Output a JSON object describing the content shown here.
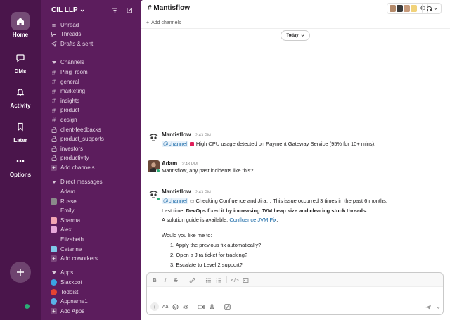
{
  "rail": {
    "items": [
      {
        "label": "Home"
      },
      {
        "label": "DMs"
      },
      {
        "label": "Activity"
      },
      {
        "label": "Later"
      },
      {
        "label": "Options"
      }
    ]
  },
  "workspace": {
    "name": "CIL LLP"
  },
  "sidebar": {
    "top": [
      {
        "label": "Unread"
      },
      {
        "label": "Threads"
      },
      {
        "label": "Drafts & sent"
      }
    ],
    "channels_header": "Channels",
    "channels": [
      {
        "label": "Ping_room",
        "type": "public"
      },
      {
        "label": "general",
        "type": "public"
      },
      {
        "label": "marketing",
        "type": "public"
      },
      {
        "label": "insights",
        "type": "public"
      },
      {
        "label": "product",
        "type": "public"
      },
      {
        "label": "design",
        "type": "public"
      },
      {
        "label": "client-feedbacks",
        "type": "private"
      },
      {
        "label": "product_supports",
        "type": "private"
      },
      {
        "label": "investors",
        "type": "private"
      },
      {
        "label": "productivity",
        "type": "private"
      }
    ],
    "add_channels": "Add channels",
    "dm_header": "Direct messages",
    "dms": [
      {
        "label": "Adam",
        "avatar": "none"
      },
      {
        "label": "Russel",
        "avatar": "#8a8a8a"
      },
      {
        "label": "Emily",
        "avatar": "none"
      },
      {
        "label": "Sharma",
        "avatar": "#f2a5b3"
      },
      {
        "label": "Alex",
        "avatar": "#e6a7d9"
      },
      {
        "label": "Elizabeth",
        "avatar": "none"
      },
      {
        "label": "Caterine",
        "avatar": "#7fc7e8"
      }
    ],
    "add_coworkers": "Add coworkers",
    "apps_header": "Apps",
    "apps": [
      {
        "label": "Slackbot",
        "avatar": "#3aa3e3"
      },
      {
        "label": "Todoist",
        "avatar": "#e44332"
      },
      {
        "label": "Appname1",
        "avatar": "#5ab0e6"
      }
    ],
    "add_apps": "Add Apps"
  },
  "channel": {
    "name": "Mantisflow",
    "member_count": "40",
    "add_channels": "Add channels",
    "date_divider": "Today"
  },
  "messages": [
    {
      "author": "Mantisflow",
      "time": "2:43 PM",
      "mention": "@channel",
      "text": "High CPU usage detected on Payment Gateway Service (95% for 10+ mins)."
    },
    {
      "author": "Adam",
      "time": "2:43 PM",
      "text": "Mantisflow, any past incidents like this?"
    },
    {
      "author": "Mantisflow",
      "time": "2:43 PM",
      "mention": "@channel",
      "text": "Checking Confluence and Jira… This issue occurred 3 times in the past 6 months.",
      "last_time_prefix": "Last time, ",
      "last_time_bold": "DevOps fixed it by increasing JVM heap size and clearing stuck threads.",
      "guide_prefix": "A solution guide is available: ",
      "guide_link": "Confluence JVM Fix",
      "guide_suffix": ".",
      "question": "Would you like me to:",
      "options": [
        "1. Apply the previous fix automatically?",
        "2. Open a Jira ticket for tracking?",
        "3. Escalate to Level 2 support?"
      ]
    }
  ],
  "composer": {
    "placeholder": ""
  },
  "colors": {
    "rail_bg": "#4a154b",
    "sidebar_bg": "#5c1d5d",
    "mention_bg": "#e8f2fb",
    "link": "#1264a3",
    "presence": "#2bac76"
  }
}
